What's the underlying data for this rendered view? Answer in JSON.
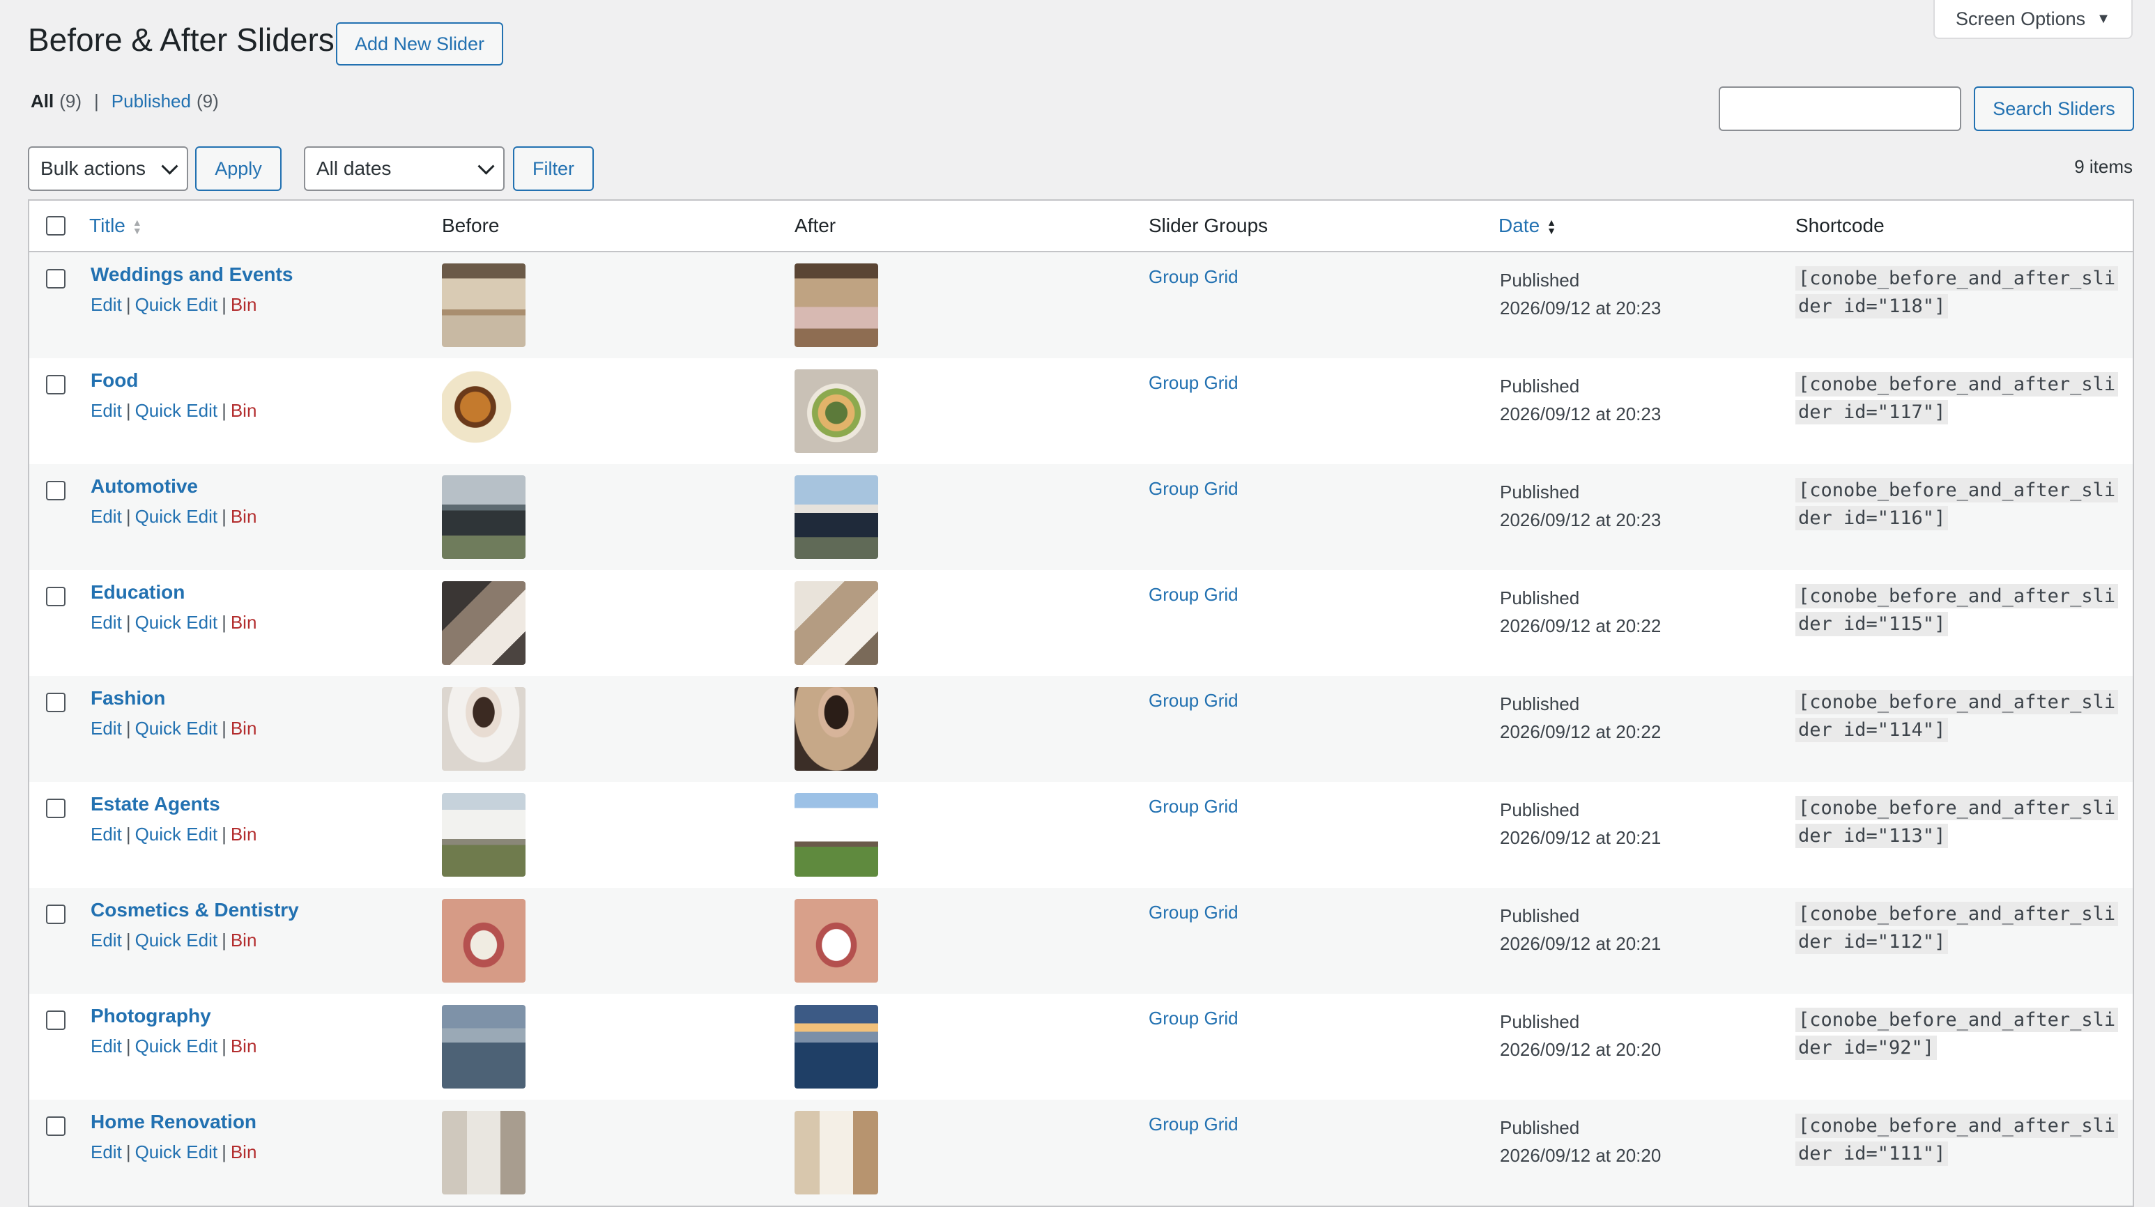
{
  "header": {
    "title": "Before & After Sliders",
    "add_new_label": "Add New Slider",
    "screen_options_label": "Screen Options"
  },
  "views": {
    "all_label": "All",
    "all_count": "(9)",
    "separator": "|",
    "published_label": "Published",
    "published_count": "(9)"
  },
  "search": {
    "placeholder": "",
    "value": "",
    "button_label": "Search Sliders"
  },
  "tablenav": {
    "bulk_actions": "Bulk actions",
    "apply_label": "Apply",
    "dates_filter": "All dates",
    "filter_label": "Filter",
    "items_count": "9 items"
  },
  "table": {
    "columns": {
      "title": "Title",
      "before": "Before",
      "after": "After",
      "groups": "Slider Groups",
      "date": "Date",
      "shortcode": "Shortcode"
    },
    "row_actions": {
      "edit": "Edit",
      "quick_edit": "Quick Edit",
      "bin": "Bin",
      "sep": "|"
    },
    "rows": [
      {
        "title": "Weddings and Events",
        "group": "Group Grid",
        "status": "Published",
        "date": "2026/09/12 at 20:23",
        "shortcode": "[conobe_before_and_after_slider id=\"118\"]",
        "before_img": "wedding-hall-before",
        "after_img": "wedding-hall-after"
      },
      {
        "title": "Food",
        "group": "Group Grid",
        "status": "Published",
        "date": "2026/09/12 at 20:23",
        "shortcode": "[conobe_before_and_after_slider id=\"117\"]",
        "before_img": "burger-fries",
        "after_img": "salad-bowl"
      },
      {
        "title": "Automotive",
        "group": "Group Grid",
        "status": "Published",
        "date": "2026/09/12 at 20:23",
        "shortcode": "[conobe_before_and_after_slider id=\"116\"]",
        "before_img": "car-dirty",
        "after_img": "car-clean"
      },
      {
        "title": "Education",
        "group": "Group Grid",
        "status": "Published",
        "date": "2026/09/12 at 20:22",
        "shortcode": "[conobe_before_and_after_slider id=\"115\"]",
        "before_img": "student-stressed",
        "after_img": "student-happy"
      },
      {
        "title": "Fashion",
        "group": "Group Grid",
        "status": "Published",
        "date": "2026/09/12 at 20:22",
        "shortcode": "[conobe_before_and_after_slider id=\"114\"]",
        "before_img": "woman-sweater",
        "after_img": "woman-blazer"
      },
      {
        "title": "Estate Agents",
        "group": "Group Grid",
        "status": "Published",
        "date": "2026/09/12 at 20:21",
        "shortcode": "[conobe_before_and_after_slider id=\"113\"]",
        "before_img": "house-before",
        "after_img": "house-after"
      },
      {
        "title": "Cosmetics & Dentistry",
        "group": "Group Grid",
        "status": "Published",
        "date": "2026/09/12 at 20:21",
        "shortcode": "[conobe_before_and_after_slider id=\"112\"]",
        "before_img": "teeth-before",
        "after_img": "teeth-after"
      },
      {
        "title": "Photography",
        "group": "Group Grid",
        "status": "Published",
        "date": "2026/09/12 at 20:20",
        "shortcode": "[conobe_before_and_after_slider id=\"92\"]",
        "before_img": "lake-dull",
        "after_img": "lake-vivid"
      },
      {
        "title": "Home Renovation",
        "group": "Group Grid",
        "status": "Published",
        "date": "2026/09/12 at 20:20",
        "shortcode": "[conobe_before_and_after_slider id=\"111\"]",
        "before_img": "room-before",
        "after_img": "room-after"
      }
    ]
  },
  "colors": {
    "link": "#2271b1",
    "danger": "#b32d2e",
    "background": "#f0f0f1"
  }
}
